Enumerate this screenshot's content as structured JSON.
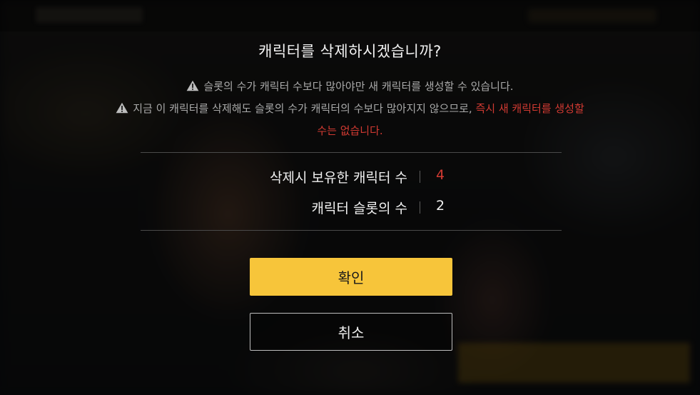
{
  "dialog": {
    "title": "캐릭터를 삭제하시겠습니까?",
    "warning_1": "슬롯의 수가 캐릭터 수보다 많아야만 새 캐릭터를 생성할 수 있습니다.",
    "warning_2_normal": "지금 이 캐릭터를 삭제해도 슬롯의 수가 캐릭터의 수보다 많아지지 않으므로, ",
    "warning_2_highlight": "즉시 새 캐릭터를 생성할",
    "warning_3_highlight": "수는 없습니다.",
    "stats": [
      {
        "label": "삭제시 보유한 캐릭터 수",
        "value": "4"
      },
      {
        "label": "캐릭터 슬롯의 수",
        "value": "2"
      }
    ],
    "confirm_label": "확인",
    "cancel_label": "취소"
  },
  "colors": {
    "accent": "#f7c53a",
    "warning_red": "#d23a32"
  },
  "icons": {
    "warning": "warning-triangle-icon"
  }
}
